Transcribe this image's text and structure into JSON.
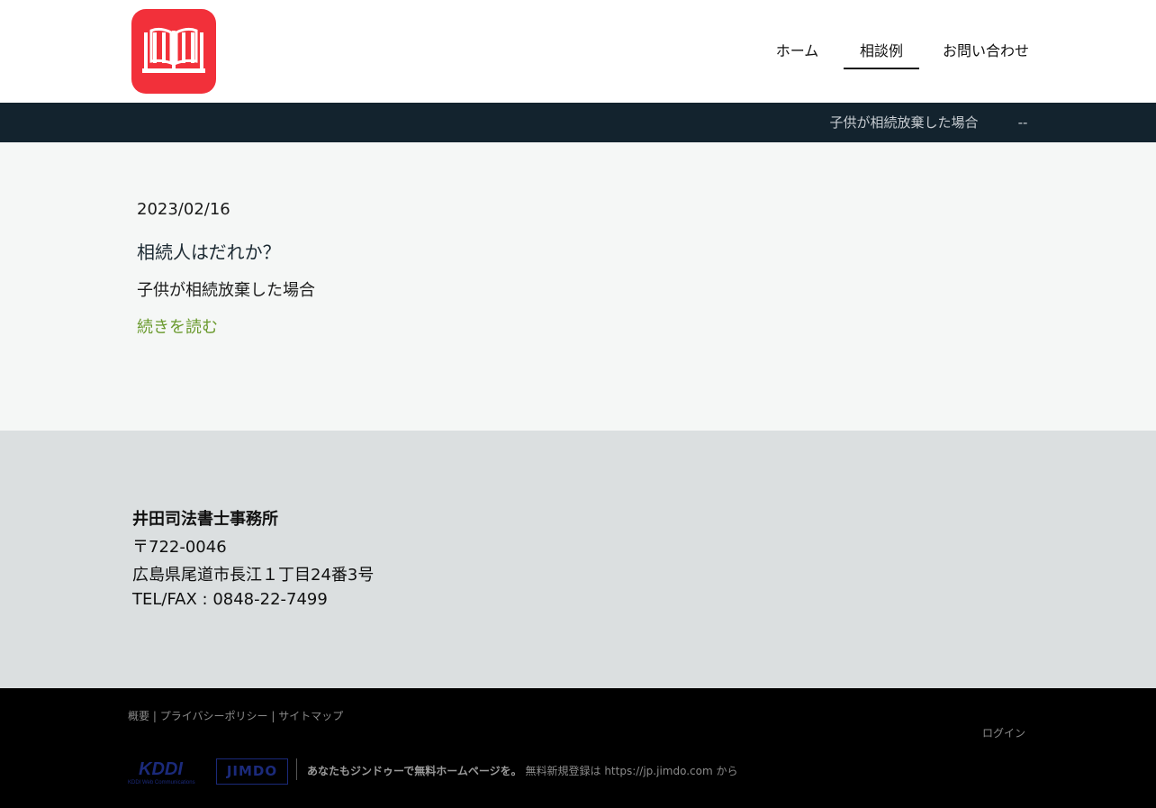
{
  "header": {
    "nav": {
      "home": "ホーム",
      "cases": "相談例",
      "contact": "お問い合わせ"
    },
    "logo_icon": "open-book-icon",
    "brand_color": "#f2303a"
  },
  "subnav": {
    "items": [
      "子供が相続放棄した場合",
      "--"
    ]
  },
  "post": {
    "date": "2023/02/16",
    "title": "相続人はだれか？",
    "excerpt": "子供が相続放棄した場合",
    "read_more": "続きを読む"
  },
  "footer": {
    "office_name": "井田司法書士事務所",
    "postal": "〒722-0046",
    "address": "広島県尾道市長江１丁目24番3号",
    "tel": "TEL/FAX : 0848-22-7499"
  },
  "bottom": {
    "links": [
      "概要",
      "プライバシーポリシー",
      "サイトマップ"
    ],
    "separator": "|",
    "login": "ログイン",
    "kddi_logo_text": "KDDI",
    "kddi_logo_sub": "KDDI Web Communications",
    "jimdo_logo_text": "JIMDO",
    "promo_bold": "あなたもジンドゥーで無料ホームページを。",
    "promo_text": "無料新規登録は https://jp.jimdo.com から"
  }
}
